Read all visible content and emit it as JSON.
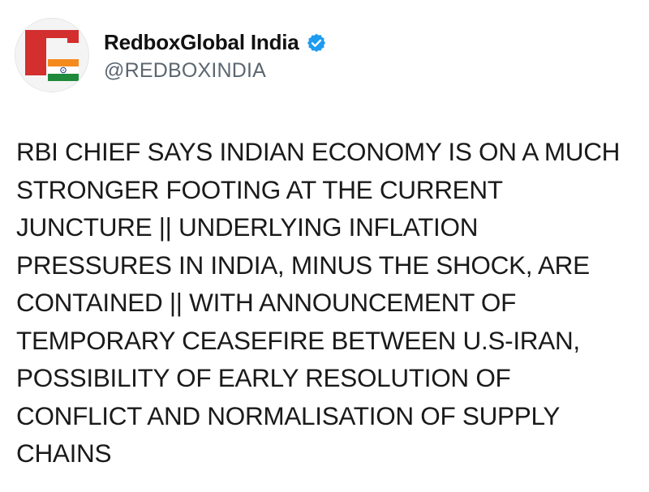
{
  "author": {
    "display_name": "RedboxGlobal India",
    "handle": "@REDBOXINDIA",
    "verified": true
  },
  "post": {
    "text": "RBI CHIEF SAYS INDIAN ECONOMY IS ON A MUCH STRONGER FOOTING AT THE CURRENT JUNCTURE || UNDERLYING INFLATION PRESSURES IN INDIA, MINUS THE SHOCK, ARE CONTAINED || WITH ANNOUNCEMENT OF TEMPORARY CEASEFIRE BETWEEN U.S-IRAN, POSSIBILITY OF EARLY RESOLUTION OF CONFLICT AND NORMALISATION OF SUPPLY CHAINS"
  },
  "icons": {
    "avatar": "redbox-india-logo-icon",
    "verified": "verified-badge-icon"
  },
  "colors": {
    "brand_red": "#d32f2f",
    "saffron": "#f58a1f",
    "india_green": "#1f8a3b",
    "verified_blue": "#1d9bf0",
    "handle_gray": "#5b6670"
  }
}
